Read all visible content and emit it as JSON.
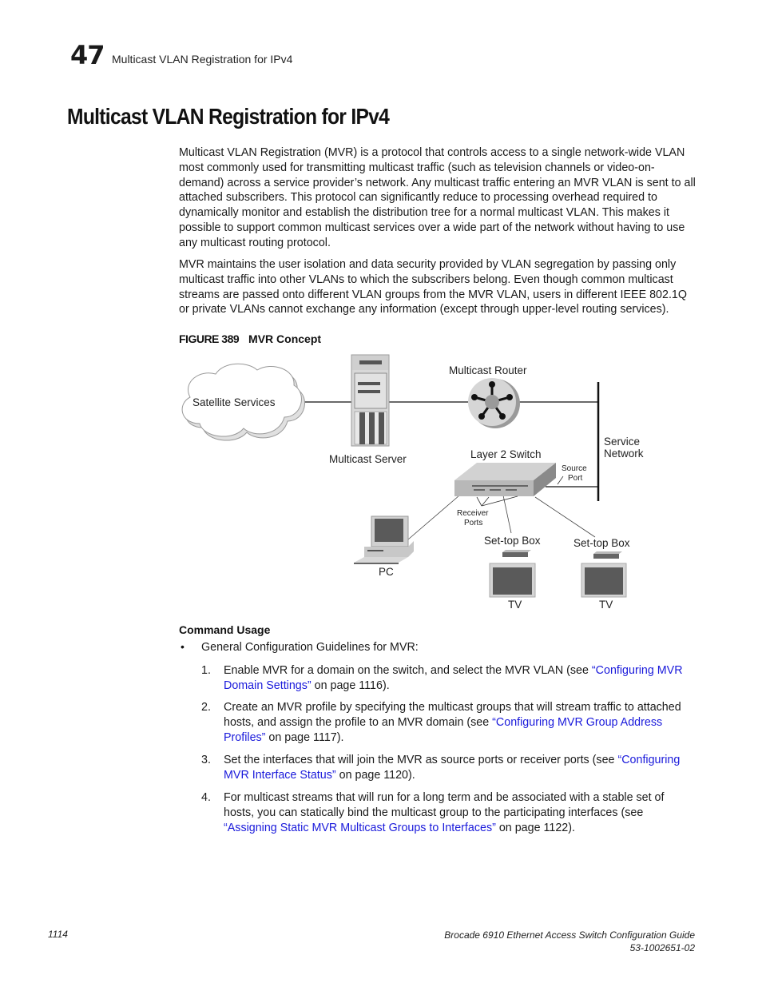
{
  "header": {
    "chapter_number": "47",
    "chapter_title": "Multicast VLAN Registration for IPv4"
  },
  "page_title": "Multicast VLAN Registration for IPv4",
  "paragraphs": [
    "Multicast VLAN Registration (MVR) is a protocol that controls access to a single network-wide VLAN most commonly used for transmitting multicast traffic (such as television channels or video-on-demand) across a service provider’s network. Any multicast traffic entering an MVR VLAN is sent to all attached subscribers. This protocol can significantly reduce to processing overhead required to dynamically monitor and establish the distribution tree for a normal multicast VLAN. This makes it possible to support common multicast services over a wide part of the network without having to use any multicast routing protocol.",
    "MVR maintains the user isolation and data security provided by VLAN segregation by passing only multicast traffic into other VLANs to which the subscribers belong. Even though common multicast streams are passed onto different VLAN groups from the MVR VLAN, users in different IEEE 802.1Q or private VLANs cannot exchange any information (except through upper-level routing services)."
  ],
  "figure": {
    "label": "FIGURE 389",
    "title": "MVR Concept",
    "nodes": {
      "satellite": "Satellite Services",
      "server": "Multicast Server",
      "router": "Multicast Router",
      "service_network_1": "Service",
      "service_network_2": "Network",
      "switch": "Layer 2 Switch",
      "source_port_1": "Source",
      "source_port_2": "Port",
      "receiver_ports_1": "Receiver",
      "receiver_ports_2": "Ports",
      "pc": "PC",
      "stb1": "Set-top Box",
      "stb2": "Set-top Box",
      "tv1": "TV",
      "tv2": "TV"
    }
  },
  "command_usage": {
    "heading": "Command Usage",
    "bullet": "General Configuration Guidelines for MVR:",
    "steps": [
      {
        "num": "1.",
        "pre": "Enable MVR for a domain on the switch, and select the MVR VLAN (see ",
        "link": "“Configuring MVR Domain Settings”",
        "post": " on page 1116)."
      },
      {
        "num": "2.",
        "pre": "Create an MVR profile by specifying the multicast groups that will stream traffic to attached hosts, and assign the profile to an MVR domain (see ",
        "link": "“Configuring MVR Group Address Profiles”",
        "post": " on page 1117)."
      },
      {
        "num": "3.",
        "pre": "Set the interfaces that will join the MVR as source ports or receiver ports (see ",
        "link": "“Configuring MVR Interface Status”",
        "post": " on page 1120)."
      },
      {
        "num": "4.",
        "pre": "For multicast streams that will run for a long term and be associated with a stable set of hosts, you can statically bind the multicast group to the participating interfaces (see ",
        "link": "“Assigning Static MVR Multicast Groups to Interfaces”",
        "post": " on page 1122)."
      }
    ]
  },
  "footer": {
    "page_number": "1114",
    "doc_title": "Brocade 6910 Ethernet Access Switch Configuration Guide",
    "doc_id": "53-1002651-02"
  },
  "colors": {
    "link": "#1a1adb",
    "icon_dark": "#5a5a5a",
    "icon_light": "#cfcfcf"
  }
}
